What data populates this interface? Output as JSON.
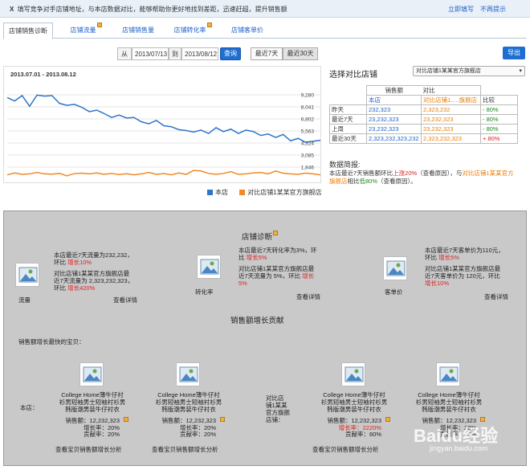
{
  "notice": {
    "close_glyph": "X",
    "text": "填写竞争对手店铺地址，与本店数据对比，能够帮助你更好地找到差距，迅速赶超，提升销售额",
    "fill_now": "立即填写",
    "dont_remind": "不再提示"
  },
  "tabs": [
    "店铺销售诊断",
    "店铺流量",
    "店铺销售量",
    "店铺转化率",
    "店铺客单价"
  ],
  "date": {
    "from_label": "从",
    "from_value": "2013/07/13",
    "to_label": "到",
    "to_value": "2013/08/12",
    "query": "查询",
    "last7": "最近7天",
    "last30": "最近30天",
    "export": "导出"
  },
  "chart_data": {
    "type": "line",
    "title": "2013.07.01 - 2013.08.12",
    "y_ticks": [
      "9,280",
      "8,041",
      "6,802",
      "5,563",
      "4,324",
      "3,085",
      "1,846"
    ],
    "ylim": [
      607,
      10519
    ],
    "series": [
      {
        "name": "本店",
        "color": "#2e74c9",
        "values": [
          9000,
          8650,
          9200,
          8100,
          9250,
          9150,
          9200,
          8400,
          8200,
          8300,
          8000,
          7550,
          7700,
          7350,
          6950,
          7200,
          6900,
          6950,
          6500,
          6300,
          6650,
          6100,
          6000,
          5700,
          5600,
          5450,
          5650,
          5300,
          5900,
          5500,
          5750,
          5300,
          5650,
          5500,
          5100,
          5250,
          4900,
          5200,
          4550,
          4800,
          4400,
          4500,
          4600
        ]
      },
      {
        "name": "对比店铺1某某官方旗舰店",
        "color": "#f08a24",
        "values": [
          1050,
          1250,
          1100,
          1150,
          1300,
          1150,
          1120,
          1200,
          950,
          1180,
          1230,
          1150,
          1250,
          1100,
          1200,
          1080,
          1160,
          1050,
          1150,
          1300,
          1100,
          1180,
          1050,
          1250,
          1100,
          1500,
          1450,
          1200,
          1100,
          1200,
          1380,
          1100,
          1150,
          1250,
          1300,
          1150,
          1450,
          1220,
          1150,
          1100,
          1230,
          1150,
          1050
        ]
      }
    ]
  },
  "compare": {
    "heading": "选择对比店铺",
    "select_value": "对比店铺1某某官方旗舰店",
    "col_sales": "销售额",
    "col_compare": "对比",
    "sub_own": "本店",
    "sub_other": "对比店铺1.....旗舰店",
    "col_ratio": "比较",
    "rows": [
      {
        "label": "昨天",
        "own": "232,323",
        "other": "2,323,232",
        "ratio": "- 80%"
      },
      {
        "label": "最近7天",
        "own": "23,232,323",
        "other": "23,232,323",
        "ratio": "- 80%"
      },
      {
        "label": "上周",
        "own": "23,232,323",
        "other": "23,232,323",
        "ratio": "- 80%"
      },
      {
        "label": "最近30天",
        "own": "2,323,232,323,232",
        "other": "2,323,232,323",
        "ratio": "+ 80%"
      }
    ]
  },
  "brief": {
    "title": "数据简报:",
    "l1_a": "本店最近7天销售额环比",
    "l1_red": "上涨20%",
    "l1_b": "（查看原因），与",
    "l1_orange": "对比店铺1某某官方",
    "l2_orange": "旗舰店",
    "l2_a": "相比",
    "l2_green": "低80%",
    "l2_b": "（查看原因）。"
  },
  "diag": {
    "title": "店铺诊断",
    "traffic": {
      "label": "流量",
      "t1": "本店最近7天流量为232,232，",
      "t2a": "环比 ",
      "t2red": "增长10%",
      "t3": "对比店铺1某某官方旗舰店最",
      "t4": "近7天流量为 2,323,232,323，",
      "t5a": "环比 ",
      "t5red": "增长420%",
      "detail": "查看详情"
    },
    "conversion": {
      "label": "转化率",
      "t1": "本店最近7天转化率为3%，环",
      "t2a": "比 ",
      "t2red": "增长5%",
      "t3": "对比店铺1某某官方旗舰店最",
      "t4a": "近7天流量为 5%，环比 ",
      "t4red": "增长",
      "t5red": "5%",
      "detail": "查看详情"
    },
    "aov": {
      "label": "客单价",
      "t1": "本店最近7天客单价为110元，",
      "t2a": "环比 ",
      "t2red": "增长5%",
      "t3": "对比店铺1某某官方旗舰店最",
      "t4a": "近7天客单价为 120元，环比",
      "t5red": "增长10%",
      "detail": "查看详情"
    },
    "growth_title": "销售额增长贡献",
    "fastest_label": "销售额增长最快的宝贝：",
    "own_label": "本店：",
    "other_label_1": "对比店",
    "other_label_2": "铺1某某",
    "other_label_3": "官方旗舰",
    "other_label_4": "店铺：",
    "product_t1": "College Home薄牛仔衬",
    "product_t2": "衫男短袖男士短袖衬衫男",
    "product_t3": "韩版潮男装牛仔衬衣",
    "products": [
      {
        "sales": "销售额：12,232,323",
        "growth": "增长率：20%",
        "contrib": "贡献率：20%",
        "growth_red": false
      },
      {
        "sales": "销售额：12,232,323",
        "growth": "增长率：20%",
        "contrib": "贡献率：20%",
        "growth_red": false
      },
      {
        "sales": "销售额：12,232,323",
        "growth": "增长率：2220%",
        "contrib": "贡献率：60%",
        "growth_red": true
      },
      {
        "sales": "销售额：12,232,323",
        "growth": "增长率：20%",
        "contrib": "贡献率：20%",
        "growth_red": false
      }
    ],
    "view_growth_link": "查看宝贝销售额增长分析",
    "view_growth_plain": "查看宝贝销售额增长分析",
    "watermark": "Baidu经验",
    "watermark_url": "jingyan.baidu.com"
  }
}
